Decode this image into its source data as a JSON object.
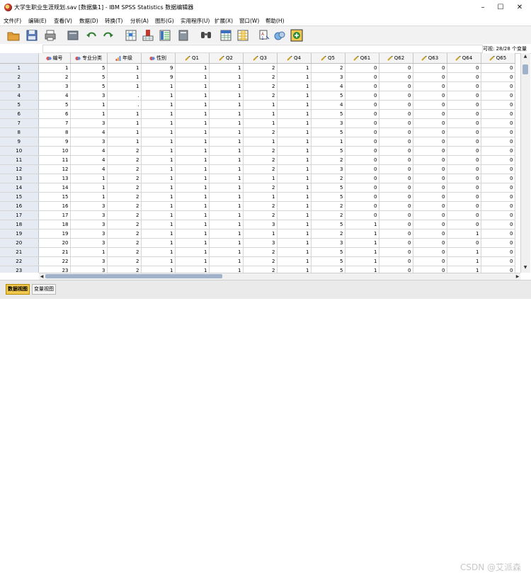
{
  "window": {
    "title": "大学生职业生涯规划.sav [数据集1] - IBM SPSS Statistics 数据编辑器",
    "minimize": "–",
    "maximize": "☐",
    "close": "✕"
  },
  "menu": [
    "文件(F)",
    "编辑(E)",
    "查看(V)",
    "数据(D)",
    "转换(T)",
    "分析(A)",
    "图形(G)",
    "实用程序(U)",
    "扩展(X)",
    "窗口(W)",
    "帮助(H)"
  ],
  "toolbar_icons": [
    "open-folder-icon",
    "save-icon",
    "print-icon",
    "dialog-recall-icon",
    "undo-icon",
    "redo-icon",
    "goto-case-icon",
    "goto-variable-icon",
    "variables-icon",
    "run-descriptives-icon",
    "find-icon",
    "insert-cases-icon",
    "insert-variable-icon",
    "split-file-icon",
    "weight-cases-icon",
    "select-cases-icon",
    "value-labels-icon",
    "use-sets-icon"
  ],
  "cellbar": {
    "visible_count": "可视: 28/28 个变量"
  },
  "grid": {
    "columns": [
      {
        "label": "编号",
        "icon": "nominal-icon"
      },
      {
        "label": "专业分类",
        "icon": "nominal-icon"
      },
      {
        "label": "年级",
        "icon": "ordinal-icon"
      },
      {
        "label": "性别",
        "icon": "nominal-icon"
      },
      {
        "label": "Q1",
        "icon": "scale-icon"
      },
      {
        "label": "Q2",
        "icon": "scale-icon"
      },
      {
        "label": "Q3",
        "icon": "scale-icon"
      },
      {
        "label": "Q4",
        "icon": "scale-icon"
      },
      {
        "label": "Q5",
        "icon": "scale-icon"
      },
      {
        "label": "Q61",
        "icon": "scale-icon"
      },
      {
        "label": "Q62",
        "icon": "scale-icon"
      },
      {
        "label": "Q63",
        "icon": "scale-icon"
      },
      {
        "label": "Q64",
        "icon": "scale-icon"
      },
      {
        "label": "Q65",
        "icon": "scale-icon"
      }
    ],
    "rows": [
      {
        "n": "1",
        "c": [
          "1",
          "5",
          "1",
          "9",
          "1",
          "1",
          "2",
          "1",
          "2",
          "0",
          "0",
          "0",
          "0",
          "0"
        ]
      },
      {
        "n": "2",
        "c": [
          "2",
          "5",
          "1",
          "9",
          "1",
          "1",
          "2",
          "1",
          "3",
          "0",
          "0",
          "0",
          "0",
          "0"
        ]
      },
      {
        "n": "3",
        "c": [
          "3",
          "5",
          "1",
          "1",
          "1",
          "1",
          "2",
          "1",
          "4",
          "0",
          "0",
          "0",
          "0",
          "0"
        ]
      },
      {
        "n": "4",
        "c": [
          "4",
          "3",
          ".",
          "1",
          "1",
          "1",
          "2",
          "1",
          "5",
          "0",
          "0",
          "0",
          "0",
          "0"
        ]
      },
      {
        "n": "5",
        "c": [
          "5",
          "1",
          ".",
          "1",
          "1",
          "1",
          "1",
          "1",
          "4",
          "0",
          "0",
          "0",
          "0",
          "0"
        ]
      },
      {
        "n": "6",
        "c": [
          "6",
          "1",
          "1",
          "1",
          "1",
          "1",
          "1",
          "1",
          "5",
          "0",
          "0",
          "0",
          "0",
          "0"
        ]
      },
      {
        "n": "7",
        "c": [
          "7",
          "3",
          "1",
          "1",
          "1",
          "1",
          "1",
          "1",
          "3",
          "0",
          "0",
          "0",
          "0",
          "0"
        ]
      },
      {
        "n": "8",
        "c": [
          "8",
          "4",
          "1",
          "1",
          "1",
          "1",
          "2",
          "1",
          "5",
          "0",
          "0",
          "0",
          "0",
          "0"
        ]
      },
      {
        "n": "9",
        "c": [
          "9",
          "3",
          "1",
          "1",
          "1",
          "1",
          "1",
          "1",
          "1",
          "0",
          "0",
          "0",
          "0",
          "0"
        ]
      },
      {
        "n": "10",
        "c": [
          "10",
          "4",
          "2",
          "1",
          "1",
          "1",
          "2",
          "1",
          "5",
          "0",
          "0",
          "0",
          "0",
          "0"
        ]
      },
      {
        "n": "11",
        "c": [
          "11",
          "4",
          "2",
          "1",
          "1",
          "1",
          "2",
          "1",
          "2",
          "0",
          "0",
          "0",
          "0",
          "0"
        ]
      },
      {
        "n": "12",
        "c": [
          "12",
          "4",
          "2",
          "1",
          "1",
          "1",
          "2",
          "1",
          "3",
          "0",
          "0",
          "0",
          "0",
          "0"
        ]
      },
      {
        "n": "13",
        "c": [
          "13",
          "1",
          "2",
          "1",
          "1",
          "1",
          "1",
          "1",
          "2",
          "0",
          "0",
          "0",
          "0",
          "0"
        ]
      },
      {
        "n": "14",
        "c": [
          "14",
          "1",
          "2",
          "1",
          "1",
          "1",
          "2",
          "1",
          "5",
          "0",
          "0",
          "0",
          "0",
          "0"
        ]
      },
      {
        "n": "15",
        "c": [
          "15",
          "1",
          "2",
          "1",
          "1",
          "1",
          "1",
          "1",
          "5",
          "0",
          "0",
          "0",
          "0",
          "0"
        ]
      },
      {
        "n": "16",
        "c": [
          "16",
          "3",
          "2",
          "1",
          "1",
          "1",
          "2",
          "1",
          "2",
          "0",
          "0",
          "0",
          "0",
          "0"
        ]
      },
      {
        "n": "17",
        "c": [
          "17",
          "3",
          "2",
          "1",
          "1",
          "1",
          "2",
          "1",
          "2",
          "0",
          "0",
          "0",
          "0",
          "0"
        ]
      },
      {
        "n": "18",
        "c": [
          "18",
          "3",
          "2",
          "1",
          "1",
          "1",
          "3",
          "1",
          "5",
          "1",
          "0",
          "0",
          "0",
          "0"
        ]
      },
      {
        "n": "19",
        "c": [
          "19",
          "3",
          "2",
          "1",
          "1",
          "1",
          "1",
          "1",
          "2",
          "1",
          "0",
          "0",
          "1",
          "0"
        ]
      },
      {
        "n": "20",
        "c": [
          "20",
          "3",
          "2",
          "1",
          "1",
          "1",
          "3",
          "1",
          "3",
          "1",
          "0",
          "0",
          "0",
          "0"
        ]
      },
      {
        "n": "21",
        "c": [
          "21",
          "1",
          "2",
          "1",
          "1",
          "1",
          "2",
          "1",
          "5",
          "1",
          "0",
          "0",
          "1",
          "0"
        ]
      },
      {
        "n": "22",
        "c": [
          "22",
          "3",
          "2",
          "1",
          "1",
          "1",
          "2",
          "1",
          "5",
          "1",
          "0",
          "0",
          "1",
          "0"
        ]
      },
      {
        "n": "23",
        "c": [
          "23",
          "3",
          "2",
          "1",
          "1",
          "1",
          "2",
          "1",
          "5",
          "1",
          "0",
          "0",
          "1",
          "0"
        ]
      }
    ]
  },
  "tabs": [
    "数据视图",
    "变量视图"
  ],
  "watermark": "CSDN @艾派森",
  "colors": {
    "active_tab": "#f2c94c",
    "row_header": "#e6ebf3",
    "scroll_thumb": "#9fb2c9"
  }
}
